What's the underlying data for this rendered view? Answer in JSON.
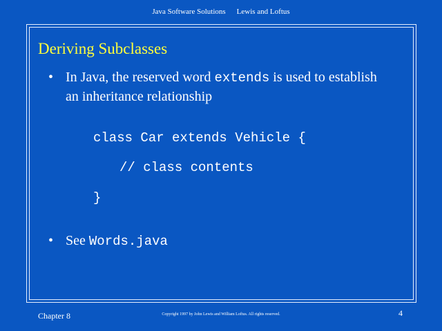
{
  "header": {
    "book_title": "Java Software Solutions",
    "authors": "Lewis and Loftus"
  },
  "slide": {
    "title": "Deriving Subclasses",
    "bullet_symbol": "•",
    "bullet1": {
      "pre": "In Java, the reserved word ",
      "code": "extends",
      "post": " is used to establish",
      "line2": "an inheritance relationship"
    },
    "code": {
      "line1": "class Car extends Vehicle {",
      "line2": "// class contents",
      "line3": "}"
    },
    "bullet2": {
      "pre": "See ",
      "code": "Words.java"
    }
  },
  "footer": {
    "chapter": "Chapter 8",
    "copyright": "Copyright 1997 by John Lewis and William Loftus.  All rights reserved.",
    "page_number": "4"
  },
  "colors": {
    "background": "#0a57c2",
    "title": "#ffff3c",
    "text": "#ffffff"
  }
}
